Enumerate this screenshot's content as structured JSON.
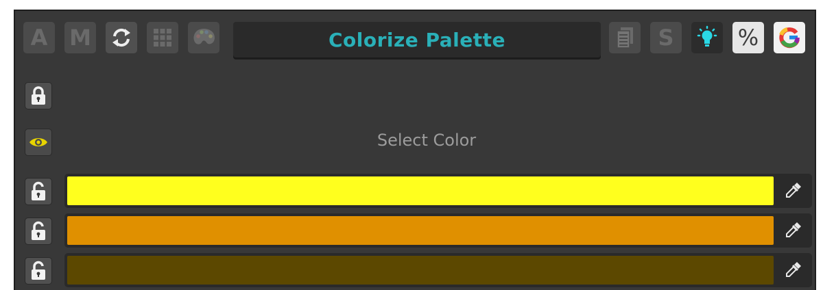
{
  "toolbar": {
    "title": "Colorize Palette",
    "left_buttons": [
      {
        "icon": "letter-a-icon",
        "glyph": "A"
      },
      {
        "icon": "letter-m-icon",
        "glyph": "M"
      },
      {
        "icon": "refresh-icon"
      },
      {
        "icon": "grid-icon"
      },
      {
        "icon": "palette-icon"
      }
    ],
    "right_buttons": [
      {
        "icon": "document-icon"
      },
      {
        "icon": "letter-s-icon",
        "glyph": "S"
      },
      {
        "icon": "lightbulb-icon"
      },
      {
        "icon": "percent-icon",
        "glyph": "%"
      },
      {
        "icon": "google-icon",
        "glyph": "G"
      }
    ]
  },
  "main": {
    "select_color_label": "Select Color"
  },
  "palette": {
    "colors": [
      {
        "hex": "#ffff1e",
        "locked": false
      },
      {
        "hex": "#e09000",
        "locked": false
      },
      {
        "hex": "#5c4800",
        "locked": false
      }
    ]
  },
  "colors": {
    "accent": "#2ab0b8",
    "eye": "#e8d400",
    "lightbulb": "#2ad8e6"
  }
}
